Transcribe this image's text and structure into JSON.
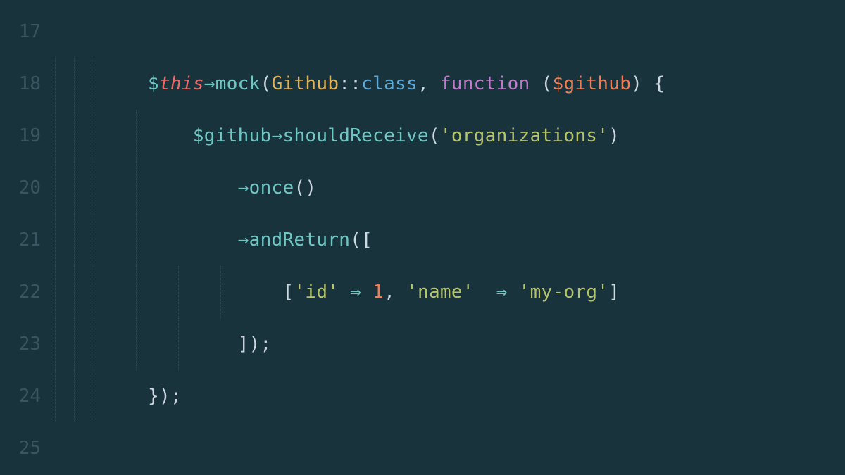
{
  "lines": [
    {
      "num": "17",
      "indent_guides": [],
      "tokens": []
    },
    {
      "num": "18",
      "indent_guides": [
        0,
        1,
        2
      ],
      "tokens": [
        {
          "cls": "tk-var",
          "t": "$"
        },
        {
          "cls": "tk-italic",
          "t": "this"
        },
        {
          "cls": "tk-arrow",
          "t": "→"
        },
        {
          "cls": "tk-method",
          "t": "mock"
        },
        {
          "cls": "tk-punct",
          "t": "("
        },
        {
          "cls": "tk-class",
          "t": "Github"
        },
        {
          "cls": "tk-scope",
          "t": "::"
        },
        {
          "cls": "tk-keyword",
          "t": "class"
        },
        {
          "cls": "tk-punct",
          "t": ", "
        },
        {
          "cls": "tk-func-kw",
          "t": "function "
        },
        {
          "cls": "tk-punct",
          "t": "("
        },
        {
          "cls": "tk-param",
          "t": "$github"
        },
        {
          "cls": "tk-punct",
          "t": ")"
        },
        {
          "cls": "tk-brace",
          "t": " {"
        }
      ]
    },
    {
      "num": "19",
      "indent_guides": [
        0,
        1,
        2,
        3
      ],
      "pad": "    ",
      "tokens": [
        {
          "cls": "tk-var",
          "t": "$github"
        },
        {
          "cls": "tk-arrow",
          "t": "→"
        },
        {
          "cls": "tk-method",
          "t": "shouldReceive"
        },
        {
          "cls": "tk-punct",
          "t": "("
        },
        {
          "cls": "tk-string",
          "t": "'organizations'"
        },
        {
          "cls": "tk-punct",
          "t": ")"
        }
      ]
    },
    {
      "num": "20",
      "indent_guides": [
        0,
        1,
        2,
        3
      ],
      "pad": "        ",
      "tokens": [
        {
          "cls": "tk-arrow",
          "t": "→"
        },
        {
          "cls": "tk-method",
          "t": "once"
        },
        {
          "cls": "tk-punct",
          "t": "()"
        }
      ]
    },
    {
      "num": "21",
      "indent_guides": [
        0,
        1,
        2,
        3
      ],
      "pad": "        ",
      "tokens": [
        {
          "cls": "tk-arrow",
          "t": "→"
        },
        {
          "cls": "tk-method",
          "t": "andReturn"
        },
        {
          "cls": "tk-punct",
          "t": "(["
        }
      ]
    },
    {
      "num": "22",
      "indent_guides": [
        0,
        1,
        2,
        3,
        4,
        5
      ],
      "pad": "            ",
      "tokens": [
        {
          "cls": "tk-punct",
          "t": "["
        },
        {
          "cls": "tk-string",
          "t": "'id'"
        },
        {
          "cls": "tk-punct",
          "t": " "
        },
        {
          "cls": "tk-fat",
          "t": "⇒"
        },
        {
          "cls": "tk-punct",
          "t": " "
        },
        {
          "cls": "tk-number",
          "t": "1"
        },
        {
          "cls": "tk-punct",
          "t": ", "
        },
        {
          "cls": "tk-string",
          "t": "'name'"
        },
        {
          "cls": "tk-punct",
          "t": " "
        },
        {
          "cls": "tk-fat",
          "t": " ⇒ "
        },
        {
          "cls": "tk-string",
          "t": "'my-org'"
        },
        {
          "cls": "tk-punct",
          "t": "]"
        }
      ]
    },
    {
      "num": "23",
      "indent_guides": [
        0,
        1,
        2,
        3,
        4
      ],
      "pad": "        ",
      "tokens": [
        {
          "cls": "tk-punct",
          "t": "]);"
        }
      ]
    },
    {
      "num": "24",
      "indent_guides": [
        0,
        1,
        2
      ],
      "tokens": [
        {
          "cls": "tk-brace",
          "t": "}"
        },
        {
          "cls": "tk-punct",
          "t": ");"
        }
      ]
    },
    {
      "num": "25",
      "indent_guides": [],
      "tokens": []
    }
  ],
  "guide_positions": [
    20,
    47,
    75,
    135,
    195,
    255
  ]
}
